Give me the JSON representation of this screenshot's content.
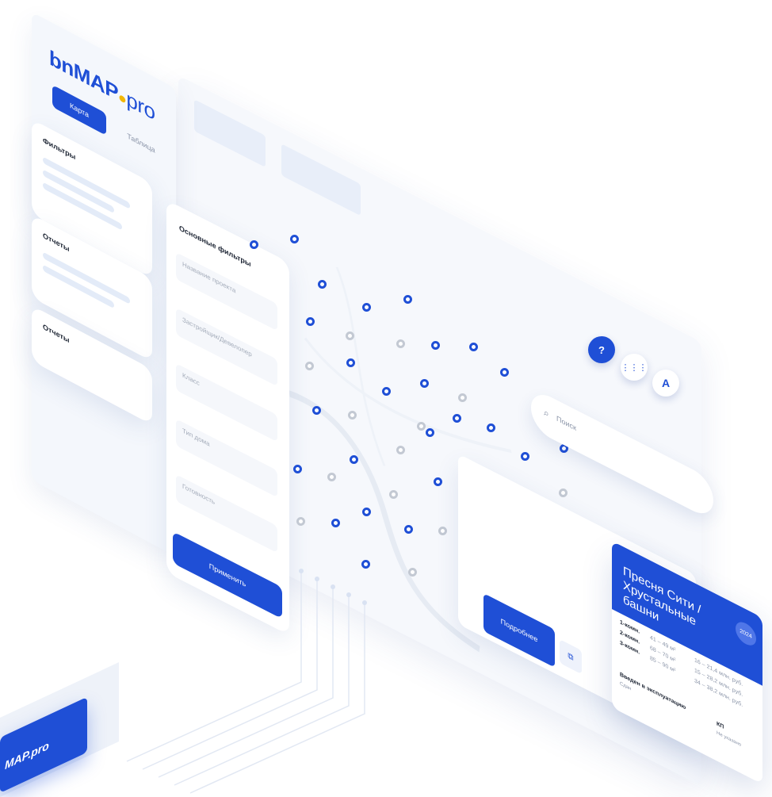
{
  "brand": {
    "logo_text": "bnMAP",
    "logo_suffix": "pro",
    "badge_text": "MAP.pro"
  },
  "sidebar": {
    "tabs": [
      {
        "label": "Карта"
      },
      {
        "label": "Таблица"
      }
    ],
    "sections": [
      {
        "title": "Фильтры"
      },
      {
        "title": "Отчеты"
      },
      {
        "title": "Отчеты"
      }
    ]
  },
  "filters": {
    "title": "Основные фильтры",
    "fields": [
      {
        "placeholder": "Название проекта"
      },
      {
        "placeholder": "Застройщик/Девелопер"
      },
      {
        "placeholder": "Класс"
      },
      {
        "placeholder": "Тип дома"
      },
      {
        "placeholder": "Готовность"
      }
    ],
    "apply_label": "Применить"
  },
  "map": {
    "search_placeholder": "Поиск",
    "controls": [
      {
        "icon": "help-icon",
        "label": "?"
      },
      {
        "icon": "grid-icon",
        "label": "⋮⋮⋮"
      },
      {
        "icon": "user-icon",
        "label": "A"
      }
    ],
    "accent_color": "#1f4fd6",
    "inactive_color": "#c3c9d3"
  },
  "project_card": {
    "title": "Пресня Сити / Хрустальные башни",
    "badge": "2024",
    "details_label": "Подробнее",
    "rows": [
      {
        "rooms": "1-комн.",
        "area": "41 – 49 м²",
        "price": "16 – 21,4 млн. руб."
      },
      {
        "rooms": "2-комн.",
        "area": "68 – 70 м²",
        "price": "15 – 28,2 млн. руб."
      },
      {
        "rooms": "3-комн.",
        "area": "85 – 90 м²",
        "price": "34 – 38,2 млн. руб."
      }
    ],
    "commissioning_label": "Введен в эксплуатацию",
    "commissioning_value": "Сдан",
    "class_label": "КП",
    "class_value": "Не указано"
  }
}
